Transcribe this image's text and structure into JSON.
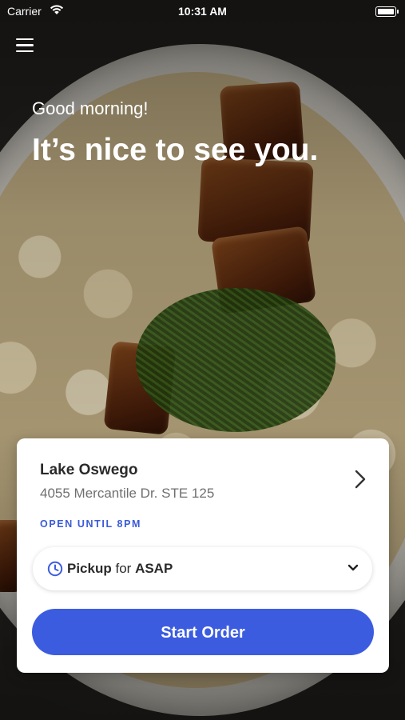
{
  "status_bar": {
    "carrier": "Carrier",
    "time": "10:31 AM",
    "wifi_icon": "wifi-icon",
    "battery_icon": "battery-icon"
  },
  "header": {
    "menu_icon": "hamburger-menu-icon",
    "greeting": "Good morning!",
    "headline": "It’s nice to see you."
  },
  "location_card": {
    "store_name": "Lake Oswego",
    "address": "4055 Mercantile Dr. STE 125",
    "open_status": "OPEN UNTIL 8PM",
    "chevron_icon": "chevron-right-icon",
    "order_type": {
      "clock_icon": "clock-icon",
      "mode": "Pickup",
      "connector": "for",
      "time": "ASAP",
      "dropdown_icon": "chevron-down-icon"
    },
    "start_button": "Start Order"
  },
  "colors": {
    "accent": "#3c5ce0",
    "open_status": "#3a5bd9"
  }
}
